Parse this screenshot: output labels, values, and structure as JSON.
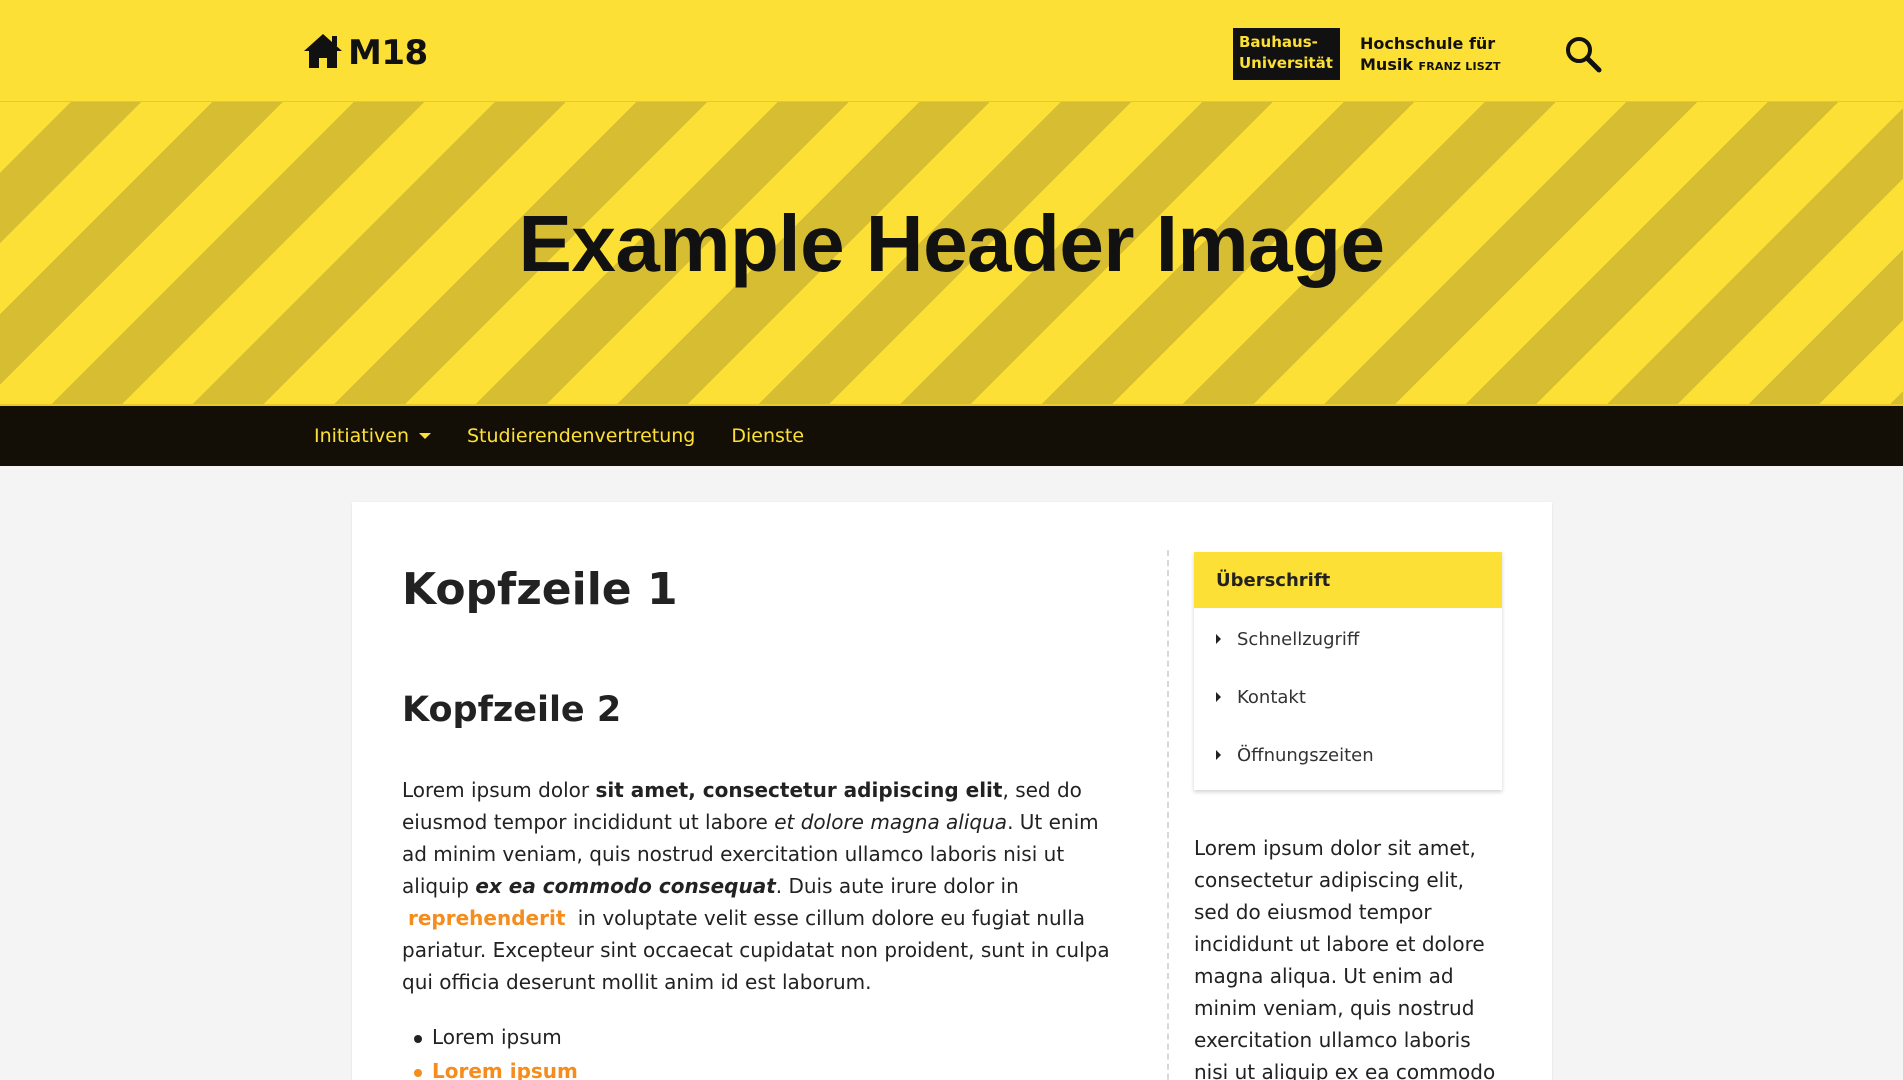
{
  "header": {
    "logo_text": "M18",
    "bauhaus_line1": "Bauhaus-",
    "bauhaus_line2": "Universität",
    "liszt_line1": "Hochschule für",
    "liszt_line2": "Musik",
    "liszt_line2_small": "FRANZ LISZT",
    "icons": {
      "home": "home-icon",
      "search": "search-icon"
    },
    "colors": {
      "primary": "#fde035",
      "dark": "#140f06",
      "stripe": "#d7bd31",
      "link": "#f58c1c"
    }
  },
  "hero": {
    "title": "Example Header Image"
  },
  "nav": {
    "items": [
      {
        "label": "Initiativen",
        "has_dropdown": true
      },
      {
        "label": "Studierendenvertretung",
        "has_dropdown": false
      },
      {
        "label": "Dienste",
        "has_dropdown": false
      }
    ]
  },
  "main": {
    "h1": "Kopfzeile 1",
    "h2": "Kopfzeile 2",
    "para": {
      "t1": "Lorem ipsum dolor ",
      "b1": "sit amet, consectetur adipiscing elit",
      "t2": ", sed do eiusmod tempor incididunt ut labore ",
      "i1": "et dolore magna aliqua",
      "t3": ". Ut enim ad minim veniam, quis nostrud exercitation ullamco laboris nisi ut aliquip ",
      "bi1": "ex ea commodo consequat",
      "t4": ". Duis aute irure dolor in ",
      "link1": "reprehenderit",
      "t5": " in voluptate velit esse cillum dolore eu fugiat nulla pariatur. Excepteur sint occaecat cupidatat non proident, sunt in culpa qui officia deserunt mollit anim id est laborum."
    },
    "list": [
      {
        "label": "Lorem ipsum"
      },
      {
        "label": "Lorem ipsum"
      }
    ]
  },
  "sidebar": {
    "panel_title": "Überschrift",
    "panel_items": [
      {
        "label": "Schnellzugriff"
      },
      {
        "label": "Kontakt"
      },
      {
        "label": "Öffnungszeiten"
      }
    ],
    "text": "Lorem ipsum dolor sit amet, consectetur adipiscing elit, sed do eiusmod tempor incididunt ut labore et dolore magna aliqua. Ut enim ad minim veniam, quis nostrud exercitation ullamco laboris nisi ut aliquip ex ea commodo"
  }
}
